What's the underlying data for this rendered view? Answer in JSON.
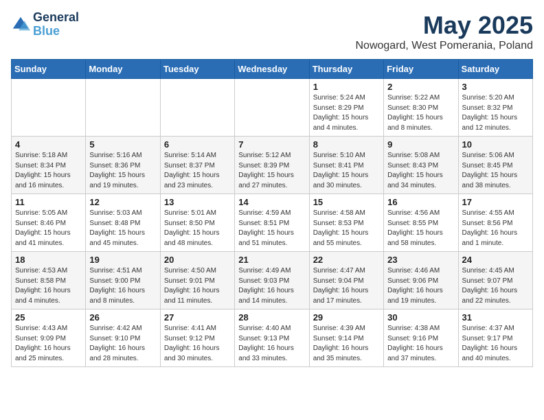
{
  "header": {
    "logo_line1": "General",
    "logo_line2": "Blue",
    "month_title": "May 2025",
    "location": "Nowogard, West Pomerania, Poland"
  },
  "weekdays": [
    "Sunday",
    "Monday",
    "Tuesday",
    "Wednesday",
    "Thursday",
    "Friday",
    "Saturday"
  ],
  "weeks": [
    [
      {
        "day": "",
        "info": ""
      },
      {
        "day": "",
        "info": ""
      },
      {
        "day": "",
        "info": ""
      },
      {
        "day": "",
        "info": ""
      },
      {
        "day": "1",
        "info": "Sunrise: 5:24 AM\nSunset: 8:29 PM\nDaylight: 15 hours\nand 4 minutes."
      },
      {
        "day": "2",
        "info": "Sunrise: 5:22 AM\nSunset: 8:30 PM\nDaylight: 15 hours\nand 8 minutes."
      },
      {
        "day": "3",
        "info": "Sunrise: 5:20 AM\nSunset: 8:32 PM\nDaylight: 15 hours\nand 12 minutes."
      }
    ],
    [
      {
        "day": "4",
        "info": "Sunrise: 5:18 AM\nSunset: 8:34 PM\nDaylight: 15 hours\nand 16 minutes."
      },
      {
        "day": "5",
        "info": "Sunrise: 5:16 AM\nSunset: 8:36 PM\nDaylight: 15 hours\nand 19 minutes."
      },
      {
        "day": "6",
        "info": "Sunrise: 5:14 AM\nSunset: 8:37 PM\nDaylight: 15 hours\nand 23 minutes."
      },
      {
        "day": "7",
        "info": "Sunrise: 5:12 AM\nSunset: 8:39 PM\nDaylight: 15 hours\nand 27 minutes."
      },
      {
        "day": "8",
        "info": "Sunrise: 5:10 AM\nSunset: 8:41 PM\nDaylight: 15 hours\nand 30 minutes."
      },
      {
        "day": "9",
        "info": "Sunrise: 5:08 AM\nSunset: 8:43 PM\nDaylight: 15 hours\nand 34 minutes."
      },
      {
        "day": "10",
        "info": "Sunrise: 5:06 AM\nSunset: 8:45 PM\nDaylight: 15 hours\nand 38 minutes."
      }
    ],
    [
      {
        "day": "11",
        "info": "Sunrise: 5:05 AM\nSunset: 8:46 PM\nDaylight: 15 hours\nand 41 minutes."
      },
      {
        "day": "12",
        "info": "Sunrise: 5:03 AM\nSunset: 8:48 PM\nDaylight: 15 hours\nand 45 minutes."
      },
      {
        "day": "13",
        "info": "Sunrise: 5:01 AM\nSunset: 8:50 PM\nDaylight: 15 hours\nand 48 minutes."
      },
      {
        "day": "14",
        "info": "Sunrise: 4:59 AM\nSunset: 8:51 PM\nDaylight: 15 hours\nand 51 minutes."
      },
      {
        "day": "15",
        "info": "Sunrise: 4:58 AM\nSunset: 8:53 PM\nDaylight: 15 hours\nand 55 minutes."
      },
      {
        "day": "16",
        "info": "Sunrise: 4:56 AM\nSunset: 8:55 PM\nDaylight: 15 hours\nand 58 minutes."
      },
      {
        "day": "17",
        "info": "Sunrise: 4:55 AM\nSunset: 8:56 PM\nDaylight: 16 hours\nand 1 minute."
      }
    ],
    [
      {
        "day": "18",
        "info": "Sunrise: 4:53 AM\nSunset: 8:58 PM\nDaylight: 16 hours\nand 4 minutes."
      },
      {
        "day": "19",
        "info": "Sunrise: 4:51 AM\nSunset: 9:00 PM\nDaylight: 16 hours\nand 8 minutes."
      },
      {
        "day": "20",
        "info": "Sunrise: 4:50 AM\nSunset: 9:01 PM\nDaylight: 16 hours\nand 11 minutes."
      },
      {
        "day": "21",
        "info": "Sunrise: 4:49 AM\nSunset: 9:03 PM\nDaylight: 16 hours\nand 14 minutes."
      },
      {
        "day": "22",
        "info": "Sunrise: 4:47 AM\nSunset: 9:04 PM\nDaylight: 16 hours\nand 17 minutes."
      },
      {
        "day": "23",
        "info": "Sunrise: 4:46 AM\nSunset: 9:06 PM\nDaylight: 16 hours\nand 19 minutes."
      },
      {
        "day": "24",
        "info": "Sunrise: 4:45 AM\nSunset: 9:07 PM\nDaylight: 16 hours\nand 22 minutes."
      }
    ],
    [
      {
        "day": "25",
        "info": "Sunrise: 4:43 AM\nSunset: 9:09 PM\nDaylight: 16 hours\nand 25 minutes."
      },
      {
        "day": "26",
        "info": "Sunrise: 4:42 AM\nSunset: 9:10 PM\nDaylight: 16 hours\nand 28 minutes."
      },
      {
        "day": "27",
        "info": "Sunrise: 4:41 AM\nSunset: 9:12 PM\nDaylight: 16 hours\nand 30 minutes."
      },
      {
        "day": "28",
        "info": "Sunrise: 4:40 AM\nSunset: 9:13 PM\nDaylight: 16 hours\nand 33 minutes."
      },
      {
        "day": "29",
        "info": "Sunrise: 4:39 AM\nSunset: 9:14 PM\nDaylight: 16 hours\nand 35 minutes."
      },
      {
        "day": "30",
        "info": "Sunrise: 4:38 AM\nSunset: 9:16 PM\nDaylight: 16 hours\nand 37 minutes."
      },
      {
        "day": "31",
        "info": "Sunrise: 4:37 AM\nSunset: 9:17 PM\nDaylight: 16 hours\nand 40 minutes."
      }
    ]
  ]
}
